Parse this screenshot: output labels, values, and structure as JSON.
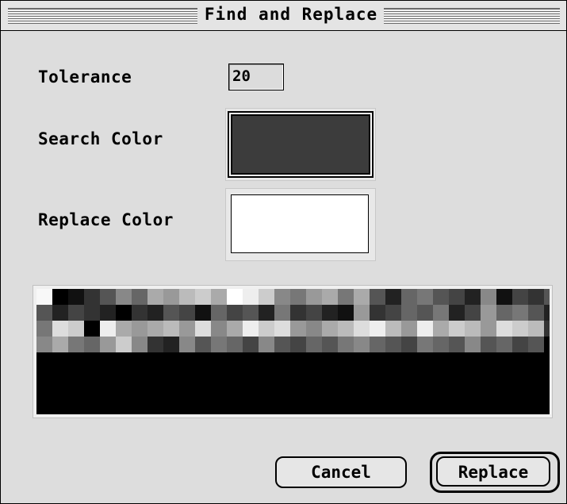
{
  "dialog": {
    "title": "Find and Replace",
    "tolerance_label": "Tolerance",
    "tolerance_value": "20",
    "search_color_label": "Search Color",
    "replace_color_label": "Replace Color",
    "search_color": "#3c3c3c",
    "replace_color": "#ffffff"
  },
  "buttons": {
    "cancel_label": "Cancel",
    "replace_label": "Replace"
  },
  "preview": {
    "rows": [
      [
        "#f8f8f8",
        "#000000",
        "#111111",
        "#333333",
        "#555555",
        "#888888",
        "#666666",
        "#aaaaaa",
        "#999999",
        "#bbbbbb",
        "#cccccc",
        "#aaaaaa",
        "#ffffff",
        "#eeeeee",
        "#cccccc",
        "#888888",
        "#777777",
        "#999999",
        "#aaaaaa",
        "#777777",
        "#aaaaaa",
        "#555555",
        "#222222",
        "#666666",
        "#777777",
        "#555555",
        "#444444",
        "#222222",
        "#888888",
        "#111111",
        "#444444",
        "#333333",
        "#555555"
      ],
      [
        "#555555",
        "#222222",
        "#444444",
        "#333333",
        "#222222",
        "#000000",
        "#333333",
        "#222222",
        "#555555",
        "#444444",
        "#111111",
        "#666666",
        "#444444",
        "#555555",
        "#222222",
        "#777777",
        "#333333",
        "#444444",
        "#222222",
        "#111111",
        "#999999",
        "#333333",
        "#444444",
        "#666666",
        "#555555",
        "#777777",
        "#222222",
        "#444444",
        "#999999",
        "#666666",
        "#777777",
        "#555555",
        "#222222"
      ],
      [
        "#777777",
        "#dddddd",
        "#cccccc",
        "#000000",
        "#eeeeee",
        "#aaaaaa",
        "#999999",
        "#aaaaaa",
        "#bbbbbb",
        "#999999",
        "#dddddd",
        "#888888",
        "#aaaaaa",
        "#eeeeee",
        "#cccccc",
        "#dddddd",
        "#999999",
        "#888888",
        "#aaaaaa",
        "#bbbbbb",
        "#dddddd",
        "#eeeeee",
        "#bbbbbb",
        "#999999",
        "#eeeeee",
        "#aaaaaa",
        "#cccccc",
        "#bbbbbb",
        "#999999",
        "#dddddd",
        "#cccccc",
        "#bbbbbb",
        "#333333"
      ],
      [
        "#888888",
        "#aaaaaa",
        "#777777",
        "#666666",
        "#999999",
        "#cccccc",
        "#888888",
        "#333333",
        "#222222",
        "#888888",
        "#555555",
        "#777777",
        "#666666",
        "#444444",
        "#888888",
        "#555555",
        "#444444",
        "#666666",
        "#555555",
        "#777777",
        "#888888",
        "#666666",
        "#555555",
        "#444444",
        "#777777",
        "#666666",
        "#555555",
        "#888888",
        "#555555",
        "#666666",
        "#444444",
        "#555555",
        "#000000"
      ]
    ]
  }
}
